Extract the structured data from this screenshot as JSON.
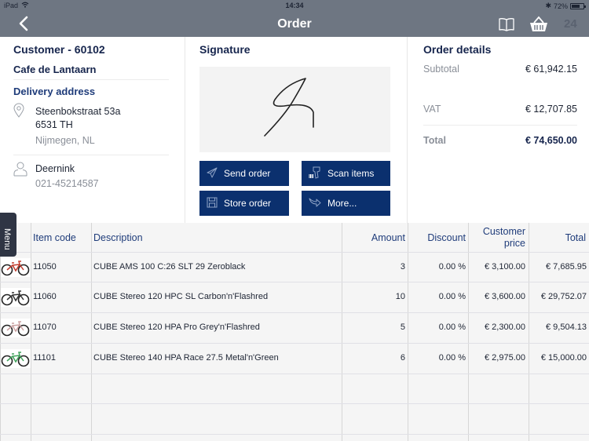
{
  "status_bar": {
    "device": "iPad",
    "time": "14:34",
    "battery_percent": "72%",
    "battery_level": 0.72
  },
  "nav": {
    "title": "Order",
    "back_icon": "chevron-left-icon",
    "catalog_icon": "book-icon",
    "basket_icon": "basket-icon",
    "basket_count": "24"
  },
  "customer": {
    "title": "Customer - 60102",
    "name": "Cafe de Lantaarn",
    "delivery_label": "Delivery address",
    "address_line1": "Steenbokstraat 53a",
    "address_line2": "6531 TH",
    "address_line3": "Nijmegen, NL",
    "contact_name": "Deernink",
    "contact_phone": "021-45214587"
  },
  "signature": {
    "title": "Signature"
  },
  "actions": {
    "send_order": "Send order",
    "scan_items": "Scan items",
    "store_order": "Store order",
    "more": "More..."
  },
  "order_details": {
    "title": "Order details",
    "subtotal_label": "Subtotal",
    "subtotal_value": "€ 61,942.15",
    "vat_label": "VAT",
    "vat_value": "€ 12,707.85",
    "total_label": "Total",
    "total_value": "€ 74,650.00"
  },
  "menu_tab": "Menu",
  "table": {
    "headers": {
      "item_code": "Item code",
      "description": "Description",
      "amount": "Amount",
      "discount": "Discount",
      "customer_price_1": "Customer",
      "customer_price_2": "price",
      "total": "Total"
    },
    "rows": [
      {
        "code": "11050",
        "description": "CUBE AMS 100 C:26 SLT 29 Zeroblack",
        "amount": "3",
        "discount": "0.00 %",
        "price": "€ 3,100.00",
        "total": "€ 7,685.95",
        "accent": "#c0392b"
      },
      {
        "code": "11060",
        "description": "CUBE Stereo 120 HPC SL Carbon'n'Flashred",
        "amount": "10",
        "discount": "0.00 %",
        "price": "€ 3,600.00",
        "total": "€ 29,752.07",
        "accent": "#333333"
      },
      {
        "code": "11070",
        "description": "CUBE Stereo 120 HPA Pro Grey'n'Flashred",
        "amount": "5",
        "discount": "0.00 %",
        "price": "€ 2,300.00",
        "total": "€ 9,504.13",
        "accent": "#c9a0a0"
      },
      {
        "code": "11101",
        "description": "CUBE Stereo 140 HPA Race 27.5 Metal'n'Green",
        "amount": "6",
        "discount": "0.00 %",
        "price": "€ 2,975.00",
        "total": "€ 15,000.00",
        "accent": "#3fa15a"
      }
    ]
  }
}
